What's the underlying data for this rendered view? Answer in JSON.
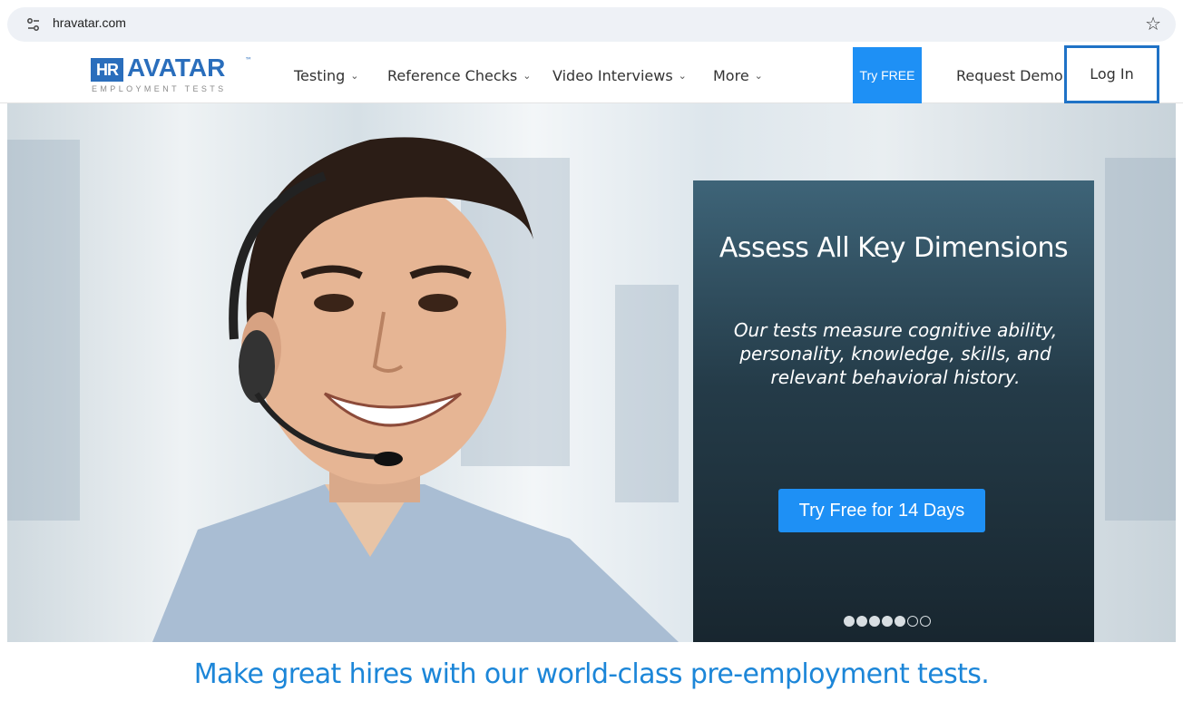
{
  "browser": {
    "url": "hravatar.com",
    "site_info_icon": "tune-icon",
    "bookmark_icon": "star-outline-icon"
  },
  "nav": {
    "logo": {
      "mark": "HR",
      "word": "AVATAR",
      "tm": "™",
      "tagline": "EMPLOYMENT TESTS"
    },
    "items": [
      {
        "label": "Testing",
        "dropdown": true
      },
      {
        "label": "Reference Checks",
        "dropdown": true
      },
      {
        "label": "Video Interviews",
        "dropdown": true
      },
      {
        "label": "More",
        "dropdown": true
      }
    ],
    "try_free": "Try FREE",
    "request_demo": "Request Demo",
    "login": "Log In",
    "chevron": "⌄"
  },
  "hero": {
    "title": "Assess All Key Dimensions",
    "body": "Our tests measure cognitive ability, personality, knowledge, skills, and relevant behavioral history.",
    "cta": "Try Free for 14 Days",
    "carousel": {
      "total": 7,
      "active_count": 5
    }
  },
  "tagline": "Make great hires with our world-class pre-employment tests.",
  "colors": {
    "brand_blue": "#2a6ebc",
    "accent_blue": "#1e90f5",
    "login_outline": "#1f72c6",
    "tagline_blue": "#1c86d8"
  }
}
